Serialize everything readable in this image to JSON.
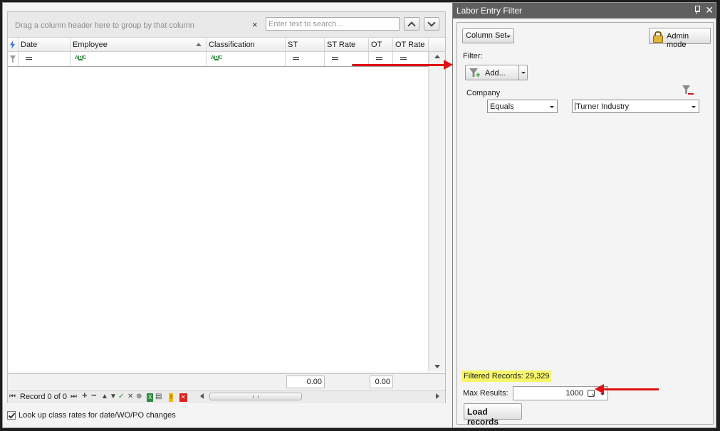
{
  "grid": {
    "group_hint": "Drag a column header here to group by that column",
    "search_placeholder": "Enter text to search...",
    "search_clear": "×",
    "columns": [
      {
        "name": "Date"
      },
      {
        "name": "Employee"
      },
      {
        "name": "Classification"
      },
      {
        "name": "ST"
      },
      {
        "name": "ST Rate"
      },
      {
        "name": "OT"
      },
      {
        "name": "OT Rate"
      }
    ],
    "filter_abc": "A B C",
    "totals": {
      "st": "0.00",
      "ot": "0.00"
    },
    "record_text": "Record 0 of 0",
    "lookup_label": "Look up class rates for date/WO/PO changes"
  },
  "filter_panel": {
    "title": "Labor Entry Filter",
    "close": "✕",
    "column_set_label": "Column Set",
    "admin_mode_label": "Admin mode",
    "filter_label": "Filter:",
    "add_label": "Add...",
    "condition": {
      "field": "Company",
      "operator": "Equals",
      "value": "Turner Industry"
    },
    "filtered_records_label": "Filtered Records:",
    "filtered_records_value": "29,329",
    "max_results_label": "Max Results:",
    "max_results_value": "1000",
    "load_records_label": "Load records"
  },
  "colors": {
    "title_bar": "#5f5f5f",
    "highlight": "#f7f76a",
    "annotation_arrow": "#e01010"
  }
}
